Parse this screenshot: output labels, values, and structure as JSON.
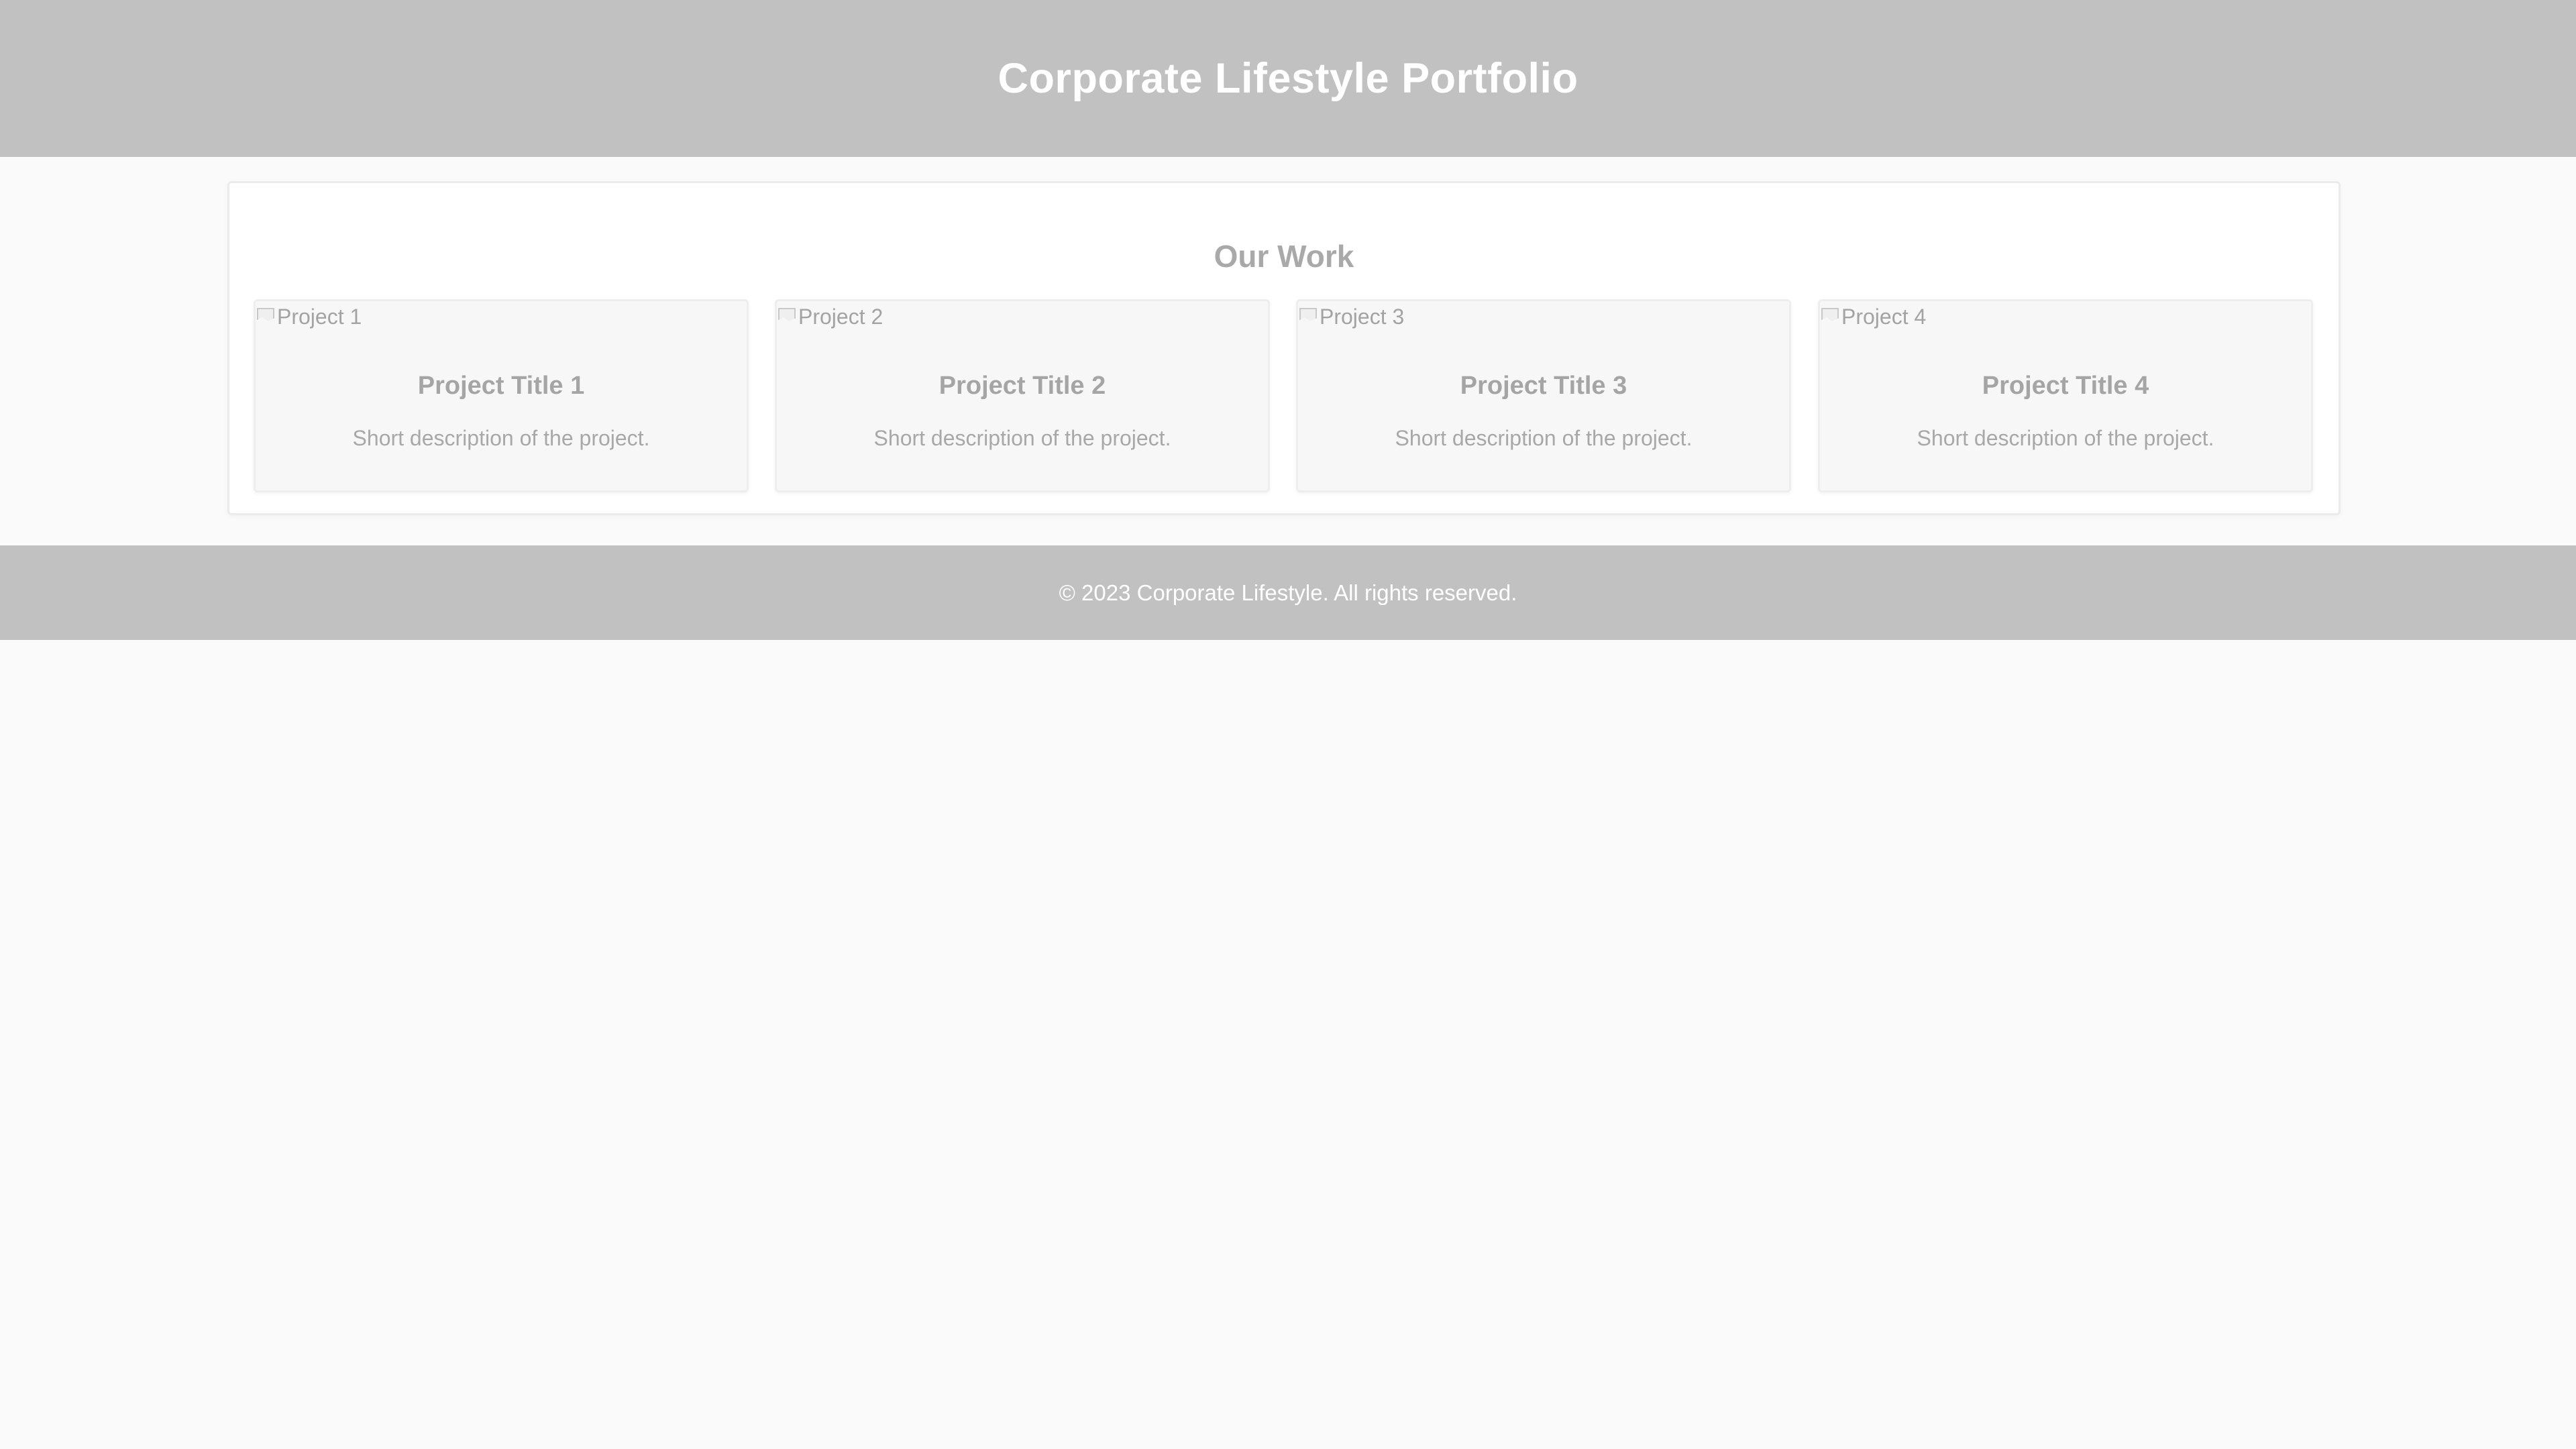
{
  "header": {
    "title": "Corporate Lifestyle Portfolio"
  },
  "work": {
    "title": "Our Work",
    "projects": [
      {
        "image_alt": "Project 1",
        "title": "Project Title 1",
        "description": "Short description of the project."
      },
      {
        "image_alt": "Project 2",
        "title": "Project Title 2",
        "description": "Short description of the project."
      },
      {
        "image_alt": "Project 3",
        "title": "Project Title 3",
        "description": "Short description of the project."
      },
      {
        "image_alt": "Project 4",
        "title": "Project Title 4",
        "description": "Short description of the project."
      }
    ]
  },
  "footer": {
    "text": "© 2023 Corporate Lifestyle. All rights reserved."
  },
  "colors": {
    "header_bg": "#c1c1c1",
    "page_bg": "#fafafa",
    "heading_text": "#a9a9a9"
  }
}
